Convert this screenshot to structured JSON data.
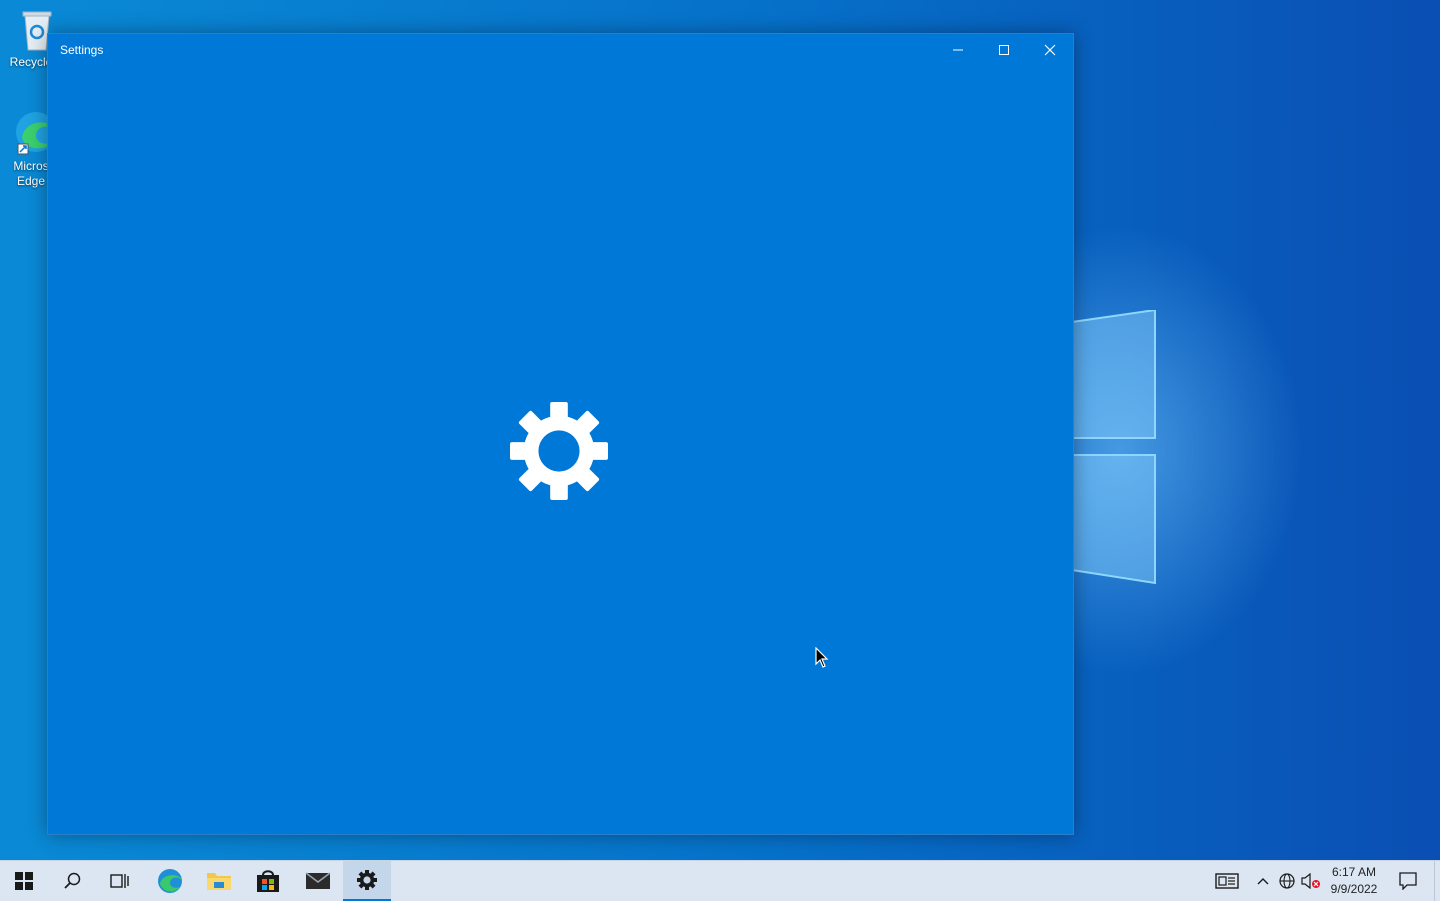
{
  "desktop": {
    "icons": [
      {
        "label": "Recycle",
        "icon": "recycle-bin-icon"
      },
      {
        "label": "Micros Edge",
        "icon": "edge-icon"
      }
    ],
    "wallpaper": "windows-10-logo"
  },
  "window": {
    "title": "Settings",
    "accent": "#0078d7",
    "controls": [
      "minimize",
      "maximize",
      "close"
    ],
    "splash_icon": "gear-icon"
  },
  "taskbar": {
    "items": [
      {
        "name": "start",
        "icon": "windows-start-icon"
      },
      {
        "name": "search",
        "icon": "search-icon"
      },
      {
        "name": "task-view",
        "icon": "task-view-icon"
      },
      {
        "name": "edge",
        "icon": "edge-icon"
      },
      {
        "name": "file-explorer",
        "icon": "folder-icon"
      },
      {
        "name": "store",
        "icon": "store-icon"
      },
      {
        "name": "mail",
        "icon": "mail-icon"
      },
      {
        "name": "settings",
        "icon": "gear-icon",
        "active": true
      }
    ],
    "tray": {
      "time": "6:17 AM",
      "date": "9/9/2022"
    }
  }
}
